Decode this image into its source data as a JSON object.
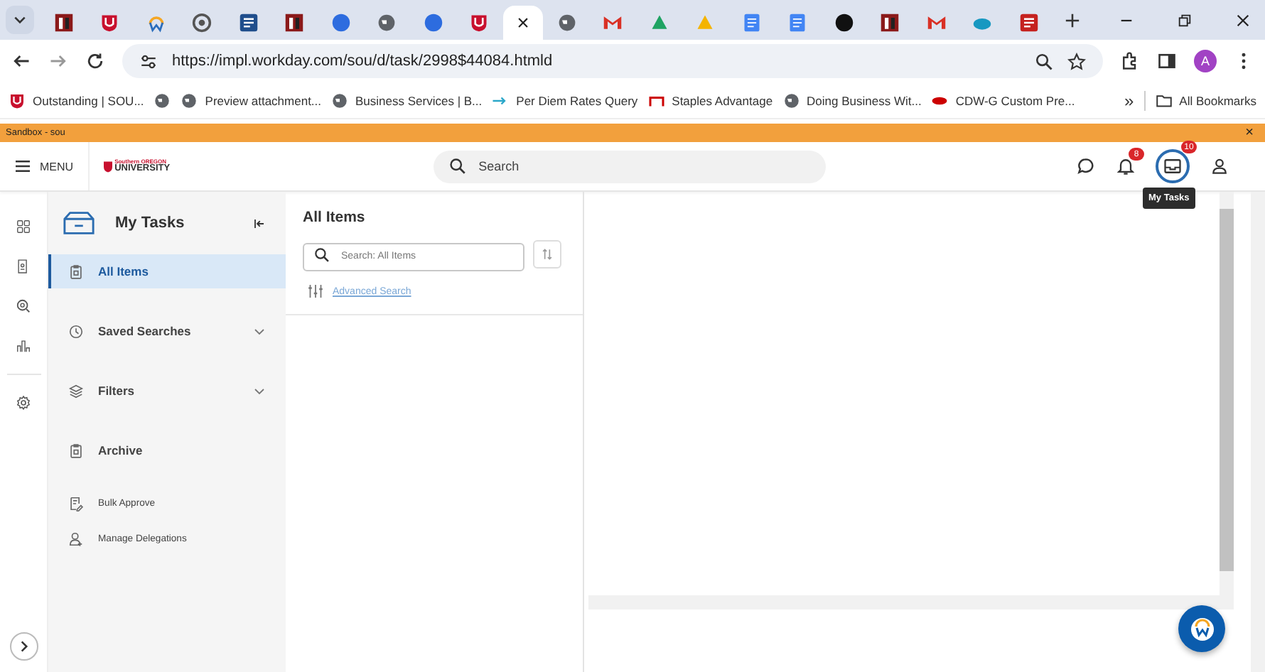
{
  "browser": {
    "tabs": [
      {
        "kind": "doc",
        "color": "#8b1a1a",
        "selected": false
      },
      {
        "kind": "shield",
        "color": "#c8102e",
        "selected": false
      },
      {
        "kind": "arc",
        "color": "#2a6dbd",
        "selected": false
      },
      {
        "kind": "seal",
        "color": "#555555",
        "selected": false
      },
      {
        "kind": "square",
        "color": "#1f4e8c",
        "selected": false
      },
      {
        "kind": "doc",
        "color": "#8b1a1a",
        "selected": false
      },
      {
        "kind": "circle",
        "color": "#2d6cdf",
        "selected": false
      },
      {
        "kind": "globe",
        "color": "#5f6368",
        "selected": false
      },
      {
        "kind": "circle",
        "color": "#2d6cdf",
        "selected": false
      },
      {
        "kind": "shield",
        "color": "#c8102e",
        "selected": false
      },
      {
        "selected": true
      },
      {
        "kind": "globe",
        "color": "#5f6368",
        "selected": false
      },
      {
        "kind": "mail",
        "color": "#d93025",
        "selected": false
      },
      {
        "kind": "triangle",
        "color": "#1ea362",
        "selected": false
      },
      {
        "kind": "triangle",
        "color": "#f4b400",
        "selected": false
      },
      {
        "kind": "page",
        "color": "#4285f4",
        "selected": false
      },
      {
        "kind": "page",
        "color": "#4285f4",
        "selected": false
      },
      {
        "kind": "circle",
        "color": "#111111",
        "selected": false
      },
      {
        "kind": "doc",
        "color": "#8b1a1a",
        "selected": false
      },
      {
        "kind": "mail",
        "color": "#d93025",
        "selected": false
      },
      {
        "kind": "cloud",
        "color": "#1798c1",
        "selected": false
      },
      {
        "kind": "square",
        "color": "#c5221f",
        "selected": false
      }
    ],
    "close_tab": "×",
    "url": "https://impl.workday.com/sou/d/task/2998$44084.htmld",
    "profile": "A",
    "bookmarks": [
      {
        "kind": "shield",
        "label": "Outstanding | SOU..."
      },
      {
        "kind": "globe"
      },
      {
        "kind": "globe",
        "label": "Preview attachment..."
      },
      {
        "kind": "globe",
        "label": "Business Services | B..."
      },
      {
        "kind": "arrow",
        "label": "Per Diem Rates Query"
      },
      {
        "kind": "staples",
        "label": "Staples Advantage"
      },
      {
        "kind": "globe",
        "label": "Doing Business Wit..."
      },
      {
        "kind": "cdw",
        "label": "CDW-G Custom Pre..."
      }
    ],
    "more_bookmarks": "»",
    "all_bookmarks": "All Bookmarks"
  },
  "sandbox_bar": {
    "label": "Sandbox - sou",
    "close": "×"
  },
  "header": {
    "menu": "MENU",
    "logo_top": "Southern OREGON",
    "logo_bottom": "UNIVERSITY",
    "search": {
      "placeholder": "Search"
    },
    "notifications_badge": "8",
    "tasks_badge": "10",
    "tooltip": "My Tasks"
  },
  "sidebar": {
    "title": "My Tasks",
    "items": [
      {
        "kind": "clipboard",
        "label": "All Items",
        "selected": true
      },
      {
        "kind": "clock",
        "label": "Saved Searches",
        "expandable": true,
        "selected": false
      },
      {
        "kind": "layers",
        "label": "Filters",
        "expandable": true,
        "selected": false
      },
      {
        "kind": "clipboard",
        "label": "Archive",
        "selected": false
      }
    ],
    "actions": [
      {
        "kind": "edit",
        "label": "Bulk Approve"
      },
      {
        "kind": "person",
        "label": "Manage Delegations"
      }
    ]
  },
  "list_pane": {
    "title": "All Items",
    "search": {
      "placeholder": "Search: All Items"
    },
    "advanced_search": "Advanced Search"
  }
}
